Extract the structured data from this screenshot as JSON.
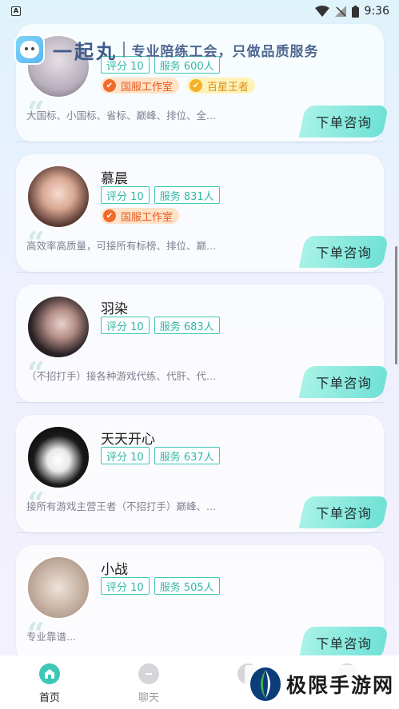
{
  "status_bar": {
    "time": "9:36",
    "left_icon": "A"
  },
  "header": {
    "app_name": "一起丸",
    "slogan": "专业陪练工会，只做品质服务"
  },
  "cards": [
    {
      "name": "",
      "rating": "评分 10",
      "service": "服务 600人",
      "badges": [
        "国服工作室",
        "百星王者"
      ],
      "desc": "大国标、小国标、省标、巅峰、排位、全...",
      "button": "下单咨询"
    },
    {
      "name": "慕晨",
      "rating": "评分 10",
      "service": "服务 831人",
      "badges": [
        "国服工作室"
      ],
      "desc": "高效率高质量，可接所有标榜、排位、巅...",
      "button": "下单咨询"
    },
    {
      "name": "羽染",
      "rating": "评分 10",
      "service": "服务 683人",
      "badges": [],
      "desc": "（不招打手）接各种游戏代练、代肝、代...",
      "button": "下单咨询"
    },
    {
      "name": "天天开心",
      "rating": "评分 10",
      "service": "服务 637人",
      "badges": [],
      "desc": "接所有游戏主营王者（不招打手）巅峰、...",
      "button": "下单咨询"
    },
    {
      "name": "小战",
      "rating": "评分 10",
      "service": "服务 505人",
      "badges": [],
      "desc": "专业靠谱...",
      "button": "下单咨询"
    }
  ],
  "bottom_nav": [
    {
      "label": "首页",
      "active": true
    },
    {
      "label": "聊天",
      "active": false
    },
    {
      "label": "",
      "active": false
    },
    {
      "label": "",
      "active": false
    }
  ],
  "watermark": "极限手游网"
}
